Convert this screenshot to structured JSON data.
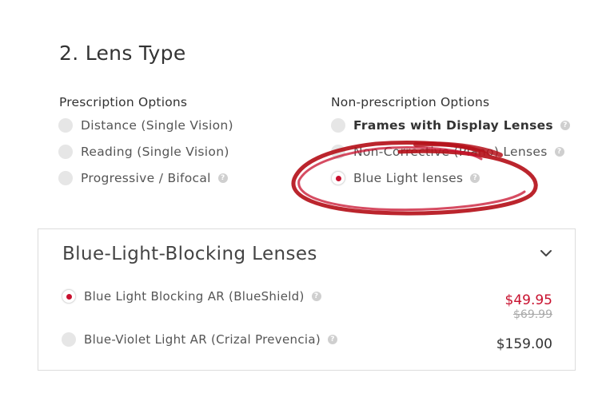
{
  "section": {
    "title": "2. Lens Type"
  },
  "prescription": {
    "heading": "Prescription Options",
    "options": [
      {
        "label": "Distance (Single Vision)"
      },
      {
        "label": "Reading (Single Vision)"
      },
      {
        "label": "Progressive / Bifocal"
      }
    ]
  },
  "non_prescription": {
    "heading": "Non-prescription Options",
    "options": [
      {
        "label": "Frames with Display Lenses"
      },
      {
        "label": "Non-Corrective (Plano) Lenses"
      },
      {
        "label": "Blue Light lenses",
        "selected": true
      }
    ]
  },
  "panel": {
    "title": "Blue-Light-Blocking Lenses",
    "items": [
      {
        "label": "Blue Light Blocking AR (BlueShield)",
        "price": "$49.95",
        "was_price": "$69.99",
        "selected": true
      },
      {
        "label": "Blue-Violet Light AR (Crizal Prevencia)",
        "price": "$159.00"
      }
    ]
  },
  "help_glyph": "?",
  "colors": {
    "accent": "#c8102e",
    "highlight_circle": "#b5121b"
  },
  "icons": [
    "help-icon",
    "chevron-down-icon"
  ]
}
